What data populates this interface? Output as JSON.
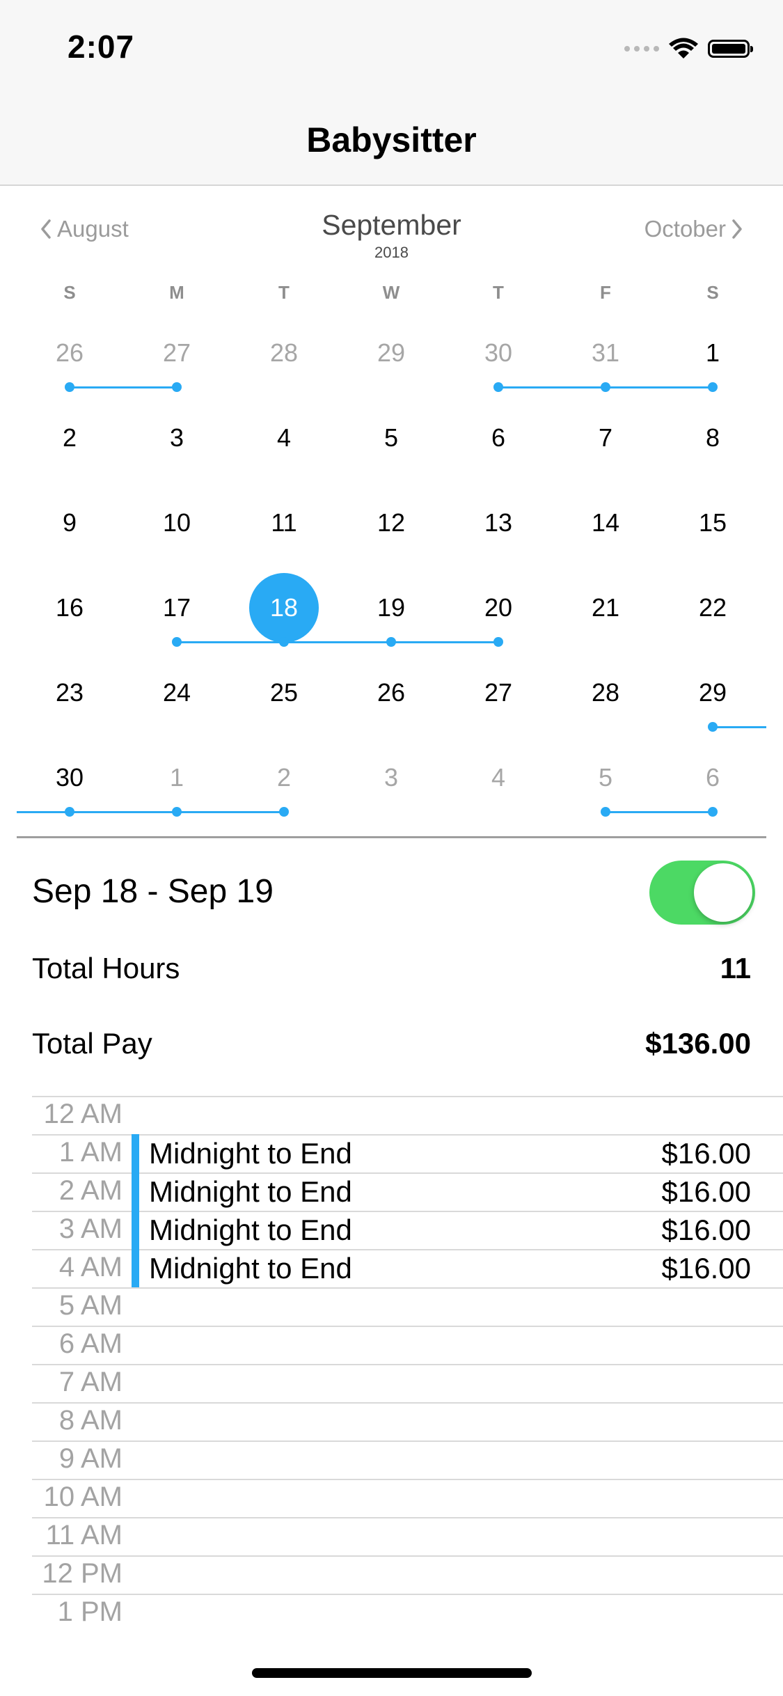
{
  "status_bar": {
    "time": "2:07"
  },
  "nav": {
    "title": "Babysitter"
  },
  "calendar": {
    "prev_month": "August",
    "next_month": "October",
    "month": "September",
    "year": "2018",
    "weekdays": [
      "S",
      "M",
      "T",
      "W",
      "T",
      "F",
      "S"
    ],
    "weeks": [
      [
        {
          "d": "26",
          "o": true
        },
        {
          "d": "27",
          "o": true
        },
        {
          "d": "28",
          "o": true
        },
        {
          "d": "29",
          "o": true
        },
        {
          "d": "30",
          "o": true
        },
        {
          "d": "31",
          "o": true
        },
        {
          "d": "1"
        }
      ],
      [
        {
          "d": "2"
        },
        {
          "d": "3"
        },
        {
          "d": "4"
        },
        {
          "d": "5"
        },
        {
          "d": "6"
        },
        {
          "d": "7"
        },
        {
          "d": "8"
        }
      ],
      [
        {
          "d": "9"
        },
        {
          "d": "10"
        },
        {
          "d": "11"
        },
        {
          "d": "12"
        },
        {
          "d": "13"
        },
        {
          "d": "14"
        },
        {
          "d": "15"
        }
      ],
      [
        {
          "d": "16"
        },
        {
          "d": "17"
        },
        {
          "d": "18",
          "sel": true
        },
        {
          "d": "19"
        },
        {
          "d": "20"
        },
        {
          "d": "21"
        },
        {
          "d": "22"
        }
      ],
      [
        {
          "d": "23"
        },
        {
          "d": "24"
        },
        {
          "d": "25"
        },
        {
          "d": "26"
        },
        {
          "d": "27"
        },
        {
          "d": "28"
        },
        {
          "d": "29"
        }
      ],
      [
        {
          "d": "30"
        },
        {
          "d": "1",
          "o": true
        },
        {
          "d": "2",
          "o": true
        },
        {
          "d": "3",
          "o": true
        },
        {
          "d": "4",
          "o": true
        },
        {
          "d": "5",
          "o": true
        },
        {
          "d": "6",
          "o": true
        }
      ]
    ],
    "booked_ranges": [
      {
        "week": 0,
        "from": 0,
        "to": 1
      },
      {
        "week": 0,
        "from": 4,
        "to": 6
      },
      {
        "week": 3,
        "from": 1,
        "to": 4
      },
      {
        "week": 4,
        "from": 6,
        "to": 6,
        "continues_right": true
      },
      {
        "week": 5,
        "from": 0,
        "to": 2,
        "continues_left": true
      },
      {
        "week": 5,
        "from": 5,
        "to": 6
      }
    ]
  },
  "summary": {
    "range": "Sep 18 - Sep 19",
    "toggle_on": true,
    "total_hours_label": "Total Hours",
    "total_hours": "11",
    "total_pay_label": "Total Pay",
    "total_pay": "$136.00"
  },
  "schedule": {
    "accent": "#29aaf4",
    "rows": [
      {
        "hour": "12 AM"
      },
      {
        "hour": "1 AM",
        "label": "Midnight to End",
        "amount": "$16.00"
      },
      {
        "hour": "2 AM",
        "label": "Midnight to End",
        "amount": "$16.00"
      },
      {
        "hour": "3 AM",
        "label": "Midnight to End",
        "amount": "$16.00"
      },
      {
        "hour": "4 AM",
        "label": "Midnight to End",
        "amount": "$16.00"
      },
      {
        "hour": "5 AM"
      },
      {
        "hour": "6 AM"
      },
      {
        "hour": "7 AM"
      },
      {
        "hour": "8 AM"
      },
      {
        "hour": "9 AM"
      },
      {
        "hour": "10 AM"
      },
      {
        "hour": "11 AM"
      },
      {
        "hour": "12 PM"
      },
      {
        "hour": "1 PM"
      }
    ]
  }
}
